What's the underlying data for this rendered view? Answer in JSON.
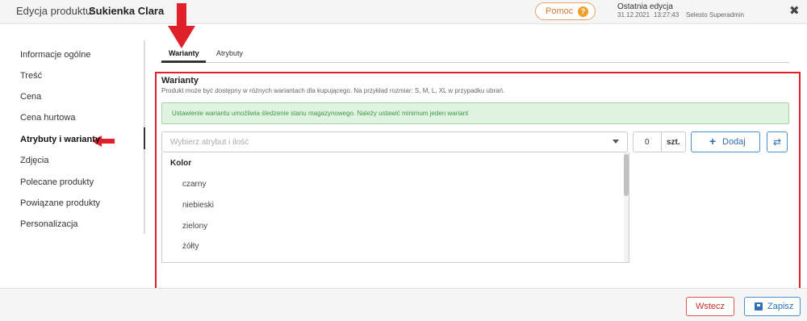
{
  "header": {
    "title_label": "Edycja produktu:",
    "title_value": "Sukienka Clara",
    "help_label": "Pomoc",
    "help_icon": "?",
    "last_edit_title": "Ostatnia edycja",
    "last_edit_date": "31.12.2021",
    "last_edit_time": "13:27:43",
    "last_edit_user": "Selesto Superadmin",
    "close_icon": "✖"
  },
  "sidebar": {
    "items": [
      {
        "label": "Informacje ogólne"
      },
      {
        "label": "Treść"
      },
      {
        "label": "Cena"
      },
      {
        "label": "Cena hurtowa"
      },
      {
        "label": "Atrybuty i warianty"
      },
      {
        "label": "Zdjęcia"
      },
      {
        "label": "Polecane produkty"
      },
      {
        "label": "Powiązane produkty"
      },
      {
        "label": "Personalizacja"
      }
    ],
    "active_index": 4
  },
  "tabs": [
    {
      "label": "Warianty"
    },
    {
      "label": "Atrybuty"
    }
  ],
  "panel": {
    "title": "Warianty",
    "description": "Produkt może być dostępny w różnych wariantach dla kupującego. Na przykład rozmiar: S, M, L, XL w przypadku ubrań.",
    "alert": "Ustawienie wariantu umożliwia śledzenie stanu magazynowego. Należy ustawić minimum jeden wariant",
    "select_placeholder": "Wybierz atrybut i ilość",
    "dropdown": {
      "group": "Kolor",
      "options": [
        "czarny",
        "niebieski",
        "zielony",
        "żółty"
      ]
    },
    "qty_value": "0",
    "qty_unit": "szt.",
    "add_icon": "+",
    "add_label": "Dodaj",
    "swap_icon": "⇄"
  },
  "footer": {
    "cancel_label": "Wstecz",
    "save_label": "Zapisz"
  },
  "colors": {
    "annotation_red": "#e0202a",
    "accent_blue": "#2f6fb3",
    "success_green": "#3c9a48",
    "help_orange": "#f0a02c"
  },
  "icons": {
    "help": "question-icon",
    "close": "close-icon",
    "caret": "chevron-down-icon",
    "add": "plus-icon",
    "swap": "swap-icon",
    "save": "floppy-icon"
  }
}
